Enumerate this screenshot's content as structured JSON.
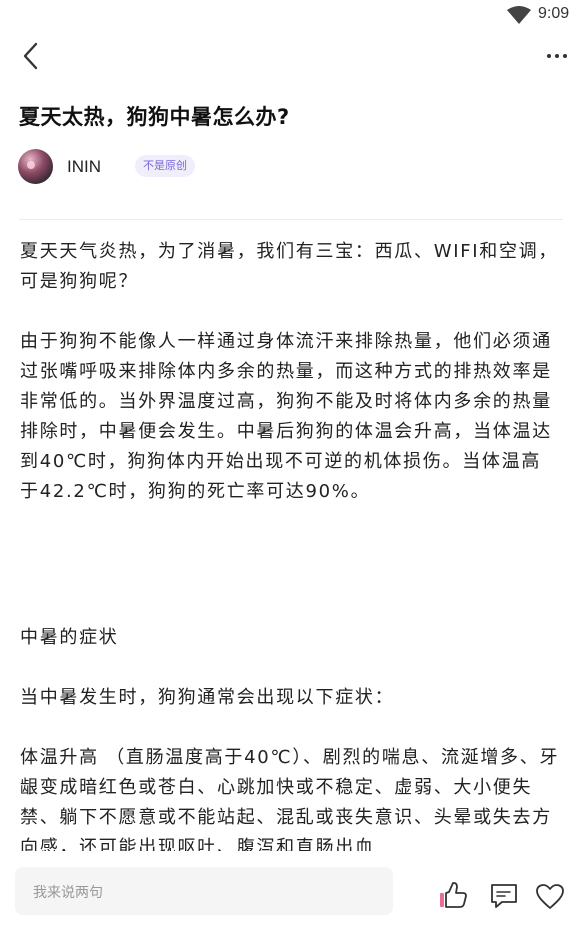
{
  "status_bar": {
    "time": "9:09",
    "wifi_icon": "wifi-icon"
  },
  "header": {
    "back_icon": "chevron-left-icon",
    "more_icon": "more-horizontal-icon"
  },
  "article": {
    "title": "夏天太热，狗狗中暑怎么办?",
    "author": {
      "name": "ININ",
      "badge": "不是原创"
    },
    "paragraphs": [
      "夏天天气炎热，为了消暑，我们有三宝：西瓜、WIFI和空调，可是狗狗呢？",
      "由于狗狗不能像人一样通过身体流汗来排除热量，他们必须通过张嘴呼吸来排除体内多余的热量，而这种方式的排热效率是非常低的。当外界温度过高，狗狗不能及时将体内多余的热量排除时，中暑便会发生。中暑后狗狗的体温会升高，当体温达到40℃时，狗狗体内开始出现不可逆的机体损伤。当体温高于42.2℃时，狗狗的死亡率可达90%。",
      "中暑的症状",
      "当中暑发生时，狗狗通常会出现以下症状：",
      "体温升高 （直肠温度高于40℃）、剧烈的喘息、流涎增多、牙龈变成暗红色或苍白、心跳加快或不稳定、虚弱、大小便失禁、躺下不愿意或不能站起、混乱或丧失意识、头晕或失去方向感，还可能出现呕吐、腹泻和直肠出血"
    ]
  },
  "bottom_bar": {
    "comment_placeholder": "我来说两句",
    "icons": [
      "thumbs-up-icon",
      "comment-icon",
      "heart-icon"
    ]
  },
  "colors": {
    "badge_bg": "#f1eefc",
    "badge_text": "#7a66d6",
    "like_accent": "#e86b9a"
  }
}
